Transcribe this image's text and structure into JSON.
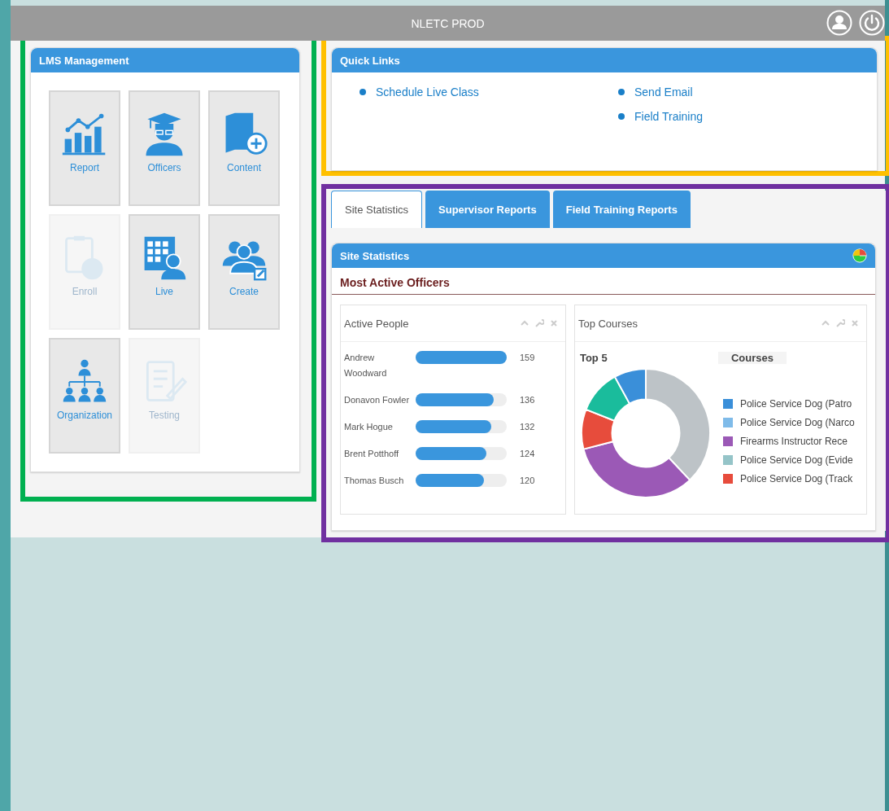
{
  "header": {
    "title": "NLETC PROD"
  },
  "lms_management": {
    "title": "LMS Management",
    "tiles": [
      {
        "label": "Report",
        "disabled": false
      },
      {
        "label": "Officers",
        "disabled": false
      },
      {
        "label": "Content",
        "disabled": false
      },
      {
        "label": "Enroll",
        "disabled": true
      },
      {
        "label": "Live",
        "disabled": false
      },
      {
        "label": "Create",
        "disabled": false
      },
      {
        "label": "Organization",
        "disabled": false
      },
      {
        "label": "Testing",
        "disabled": true
      }
    ]
  },
  "quick_links": {
    "title": "Quick Links",
    "columns": [
      [
        "Schedule Live Class"
      ],
      [
        "Send Email",
        "Field Training"
      ]
    ]
  },
  "tabs": [
    {
      "label": "Site Statistics",
      "selected": true
    },
    {
      "label": "Supervisor Reports",
      "selected": false
    },
    {
      "label": "Field Training Reports",
      "selected": false
    }
  ],
  "site_statistics": {
    "title": "Site Statistics",
    "subtitle": "Most Active Officers",
    "active_people": {
      "title": "Active People",
      "rows": [
        {
          "name": "Andrew Woodward",
          "level": 1.0,
          "count": "159"
        },
        {
          "name": "Donavon Fowler",
          "level": 0.86,
          "count": "136"
        },
        {
          "name": "Mark Hogue",
          "level": 0.83,
          "count": "132"
        },
        {
          "name": "Brent Potthoff",
          "level": 0.78,
          "count": "124"
        },
        {
          "name": "Thomas Busch",
          "level": 0.75,
          "count": "120"
        }
      ]
    },
    "top_courses": {
      "title": "Top Courses",
      "column_1": "Top 5",
      "column_2": "Courses",
      "legend": [
        {
          "label": "Police Service Dog (Patro",
          "color": "#3a8fd9"
        },
        {
          "label": "Police Service Dog (Narco",
          "color": "#7fbbe9"
        },
        {
          "label": "Firearms Instructor Rece",
          "color": "#9b59b6"
        },
        {
          "label": "Police Service Dog (Evide",
          "color": "#95c4c8"
        },
        {
          "label": "Police Service Dog (Track",
          "color": "#e74c3c"
        }
      ]
    }
  }
}
